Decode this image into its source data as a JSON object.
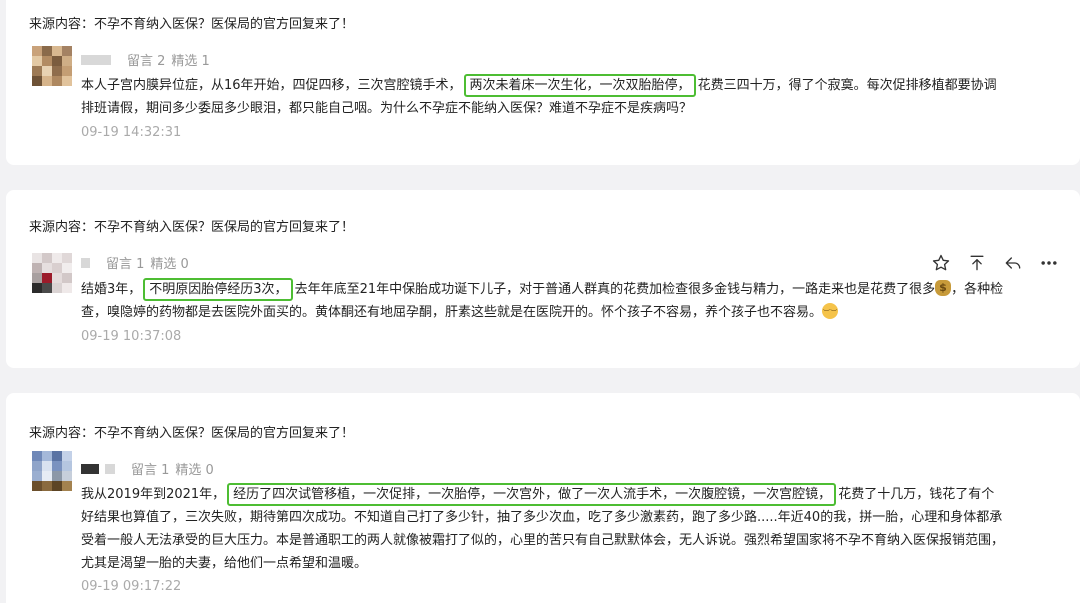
{
  "comments": [
    {
      "source": "来源内容：不孕不育纳入医保？医保局的官方回复来了！",
      "reply_count": "留言 2",
      "featured_count": "精选 1",
      "text_before": "本人子宫内膜异位症，从16年开始，四促四移，三次宫腔镜手术，",
      "highlight": "两次未着床一次生化，一次双胎胎停，",
      "text_after": "花费三四十万，得了个寂寞。每次促排移植都要协调排班请假，期间多少委屈多少眼泪，都只能自己咽。为什么不孕症不能纳入医保？难道不孕症不是疾病吗？",
      "time": "09-19 14:32:31"
    },
    {
      "source": "来源内容：不孕不育纳入医保？医保局的官方回复来了！",
      "reply_count": "留言 1",
      "featured_count": "精选 0",
      "text_before": "结婚3年，",
      "highlight": "不明原因胎停经历3次，",
      "text_after": "去年年底至21年中保胎成功诞下儿子，对于普通人群真的花费加检查很多金钱与精力，一路走来也是花费了很多",
      "emoji_1": "money-bag-emoji",
      "text_after_2": "，各种检查，嗅隐婷的药物都是去医院外面买的。黄体酮还有地屈孕酮，肝素这些就是在医院开的。怀个孩子不容易，养个孩子也不容易。",
      "emoji_2": "pensive-face-emoji",
      "time": "09-19 10:37:08",
      "actions": [
        "star-icon",
        "pin-top-icon",
        "reply-icon",
        "more-icon"
      ]
    },
    {
      "source": "来源内容：不孕不育纳入医保？医保局的官方回复来了！",
      "reply_count": "留言 1",
      "featured_count": "精选 0",
      "text_before": "我从2019年到2021年，",
      "highlight": "经历了四次试管移植，一次促排，一次胎停，一次宫外，做了一次人流手术，一次腹腔镜，一次宫腔镜，",
      "text_after": "花费了十几万，钱花了有个好结果也算值了，三次失败，期待第四次成功。不知道自己打了多少针，抽了多少次血，吃了多少激素药，跑了多少路.....年近40的我，拼一胎，心理和身体都承受着一般人无法承受的巨大压力。本是普通职工的两人就像被霜打了似的，心里的苦只有自己默默体会，无人诉说。强烈希望国家将不孕不育纳入医保报销范围，尤其是渴望一胎的夫妻，给他们一点希望和温暖。",
      "time": "09-19 09:17:22"
    }
  ],
  "colors": {
    "highlight_border": "#4dbd33",
    "page_bg": "#f2f2f4",
    "card_bg": "#ffffff",
    "meta_text": "#999999"
  }
}
